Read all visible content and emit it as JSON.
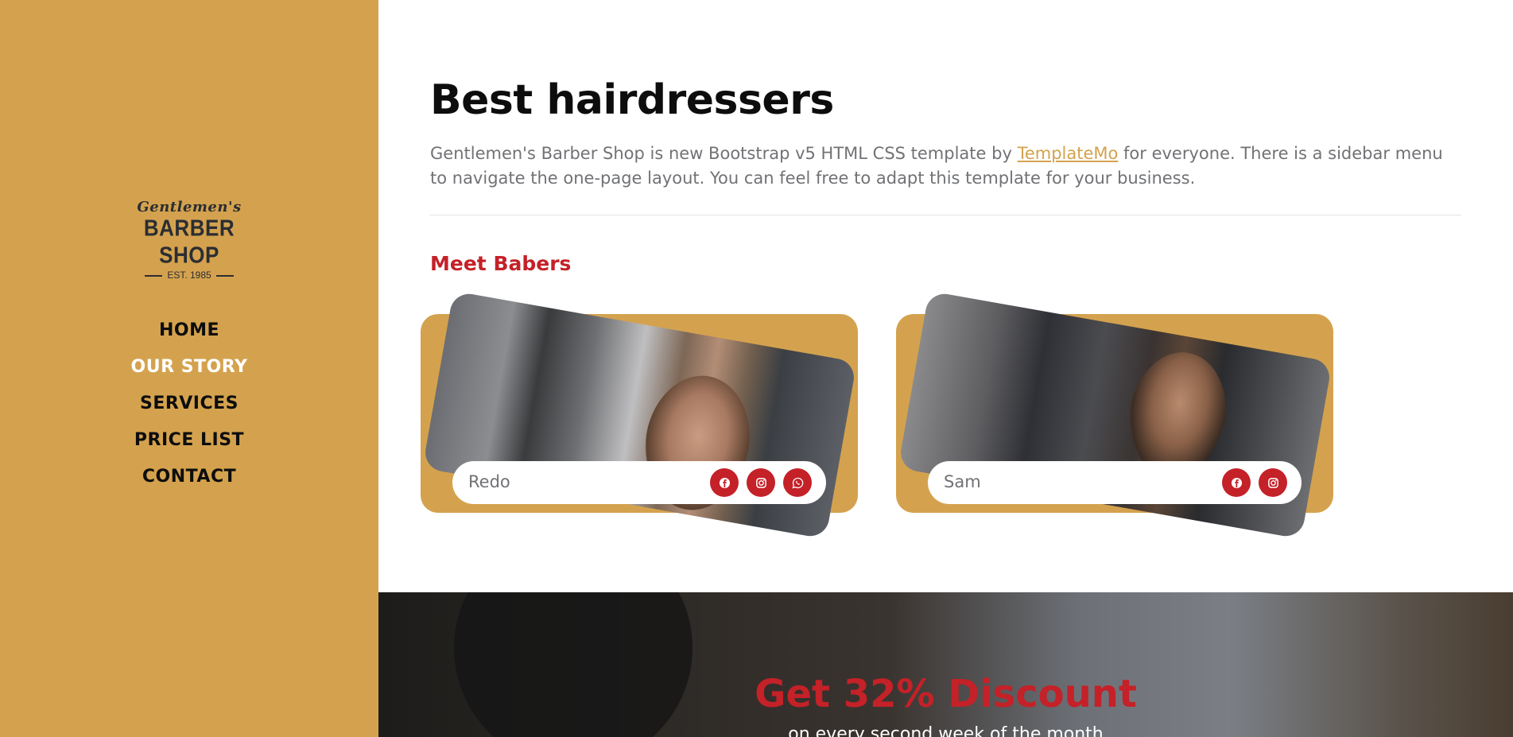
{
  "brand": {
    "script": "Gentlemen's",
    "main": "BARBER SHOP",
    "sub": "EST. 1985"
  },
  "nav": {
    "items": [
      "HOME",
      "OUR STORY",
      "SERVICES",
      "PRICE LIST",
      "CONTACT"
    ],
    "active": "OUR STORY"
  },
  "hero": {
    "title": "Best hairdressers",
    "intro_before": "Gentlemen's Barber Shop is new Bootstrap v5 HTML CSS template by ",
    "intro_link": "TemplateMo",
    "intro_after": " for everyone. There is a sidebar menu to navigate the one-page layout. You can feel free to adapt this template for your business."
  },
  "team": {
    "heading": "Meet Babers",
    "barbers": [
      {
        "name": "Redo",
        "socials": [
          "facebook-icon",
          "instagram-icon",
          "whatsapp-icon"
        ]
      },
      {
        "name": "Sam",
        "socials": [
          "facebook-icon",
          "instagram-icon"
        ]
      }
    ]
  },
  "promo": {
    "title": "Get 32% Discount",
    "subtitle": "on every second week of the month"
  },
  "colors": {
    "sidebar": "#d4a24e",
    "accent": "#c42128",
    "link": "#d4a24e",
    "text_muted": "#717275"
  }
}
